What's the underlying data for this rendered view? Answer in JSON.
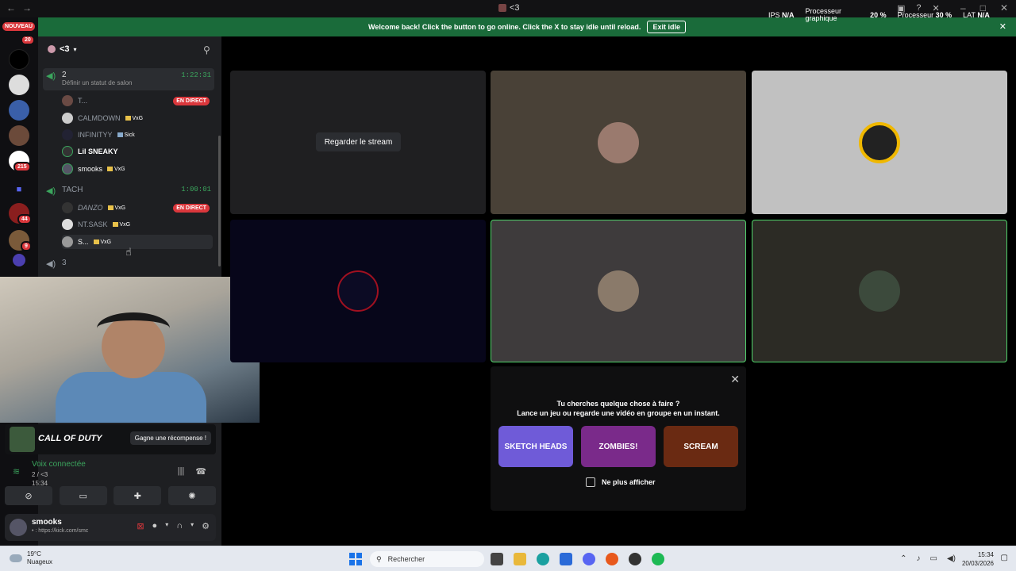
{
  "window": {
    "title": "<3"
  },
  "banner": {
    "message": "Welcome back! Click the button to go online. Click the X to stay idle until reload.",
    "exit_label": "Exit idle"
  },
  "perf": {
    "ips_label": "IPS",
    "ips_value": "N/A",
    "gpu_label_1": "Processeur",
    "gpu_label_2": "graphique",
    "gpu_value": "20 %",
    "cpu_label": "Processeur",
    "cpu_value": "30 %",
    "lat_label": "LAT",
    "lat_value": "N/A"
  },
  "servers": {
    "new_label": "NOUVEAU",
    "new_count": "20",
    "badge_a": "215",
    "badge_b": "44",
    "badge_c": "9"
  },
  "sidebar": {
    "server_name": "<3",
    "channels": [
      {
        "name": "2",
        "time": "1:22:31",
        "status": "Définir un statut de salon"
      },
      {
        "name": "TACH",
        "time": "1:00:01"
      },
      {
        "name": "3"
      }
    ],
    "members_ch1": [
      {
        "name": "T...",
        "tag": "",
        "live": "EN DIRECT"
      },
      {
        "name": "CALMDOWN",
        "tag": "VxG"
      },
      {
        "name": "INFINITYY",
        "tag": "Sick"
      },
      {
        "name": "Lil SNEAKY",
        "tag": ""
      },
      {
        "name": "smooks",
        "tag": "VxG"
      }
    ],
    "members_ch2": [
      {
        "name": "DANZO",
        "tag": "VxG",
        "live": "EN DIRECT"
      },
      {
        "name": "NT.SASK",
        "tag": "VxG"
      },
      {
        "name": "S...",
        "tag": "VxG"
      }
    ]
  },
  "promo": {
    "game": "CALL OF DUTY",
    "reward": "Gagne une récompense !"
  },
  "voice": {
    "status": "Voix connectée",
    "channel": "2 / <3",
    "time": "15:34"
  },
  "user": {
    "name": "smooks",
    "status": "• : https://kick.com/smc"
  },
  "stage": {
    "watch_stream": "Regarder le stream"
  },
  "activity": {
    "line1": "Tu cherches quelque chose à faire ?",
    "line2": "Lance un jeu ou regarde une vidéo en groupe en un instant.",
    "games": [
      "SKETCH HEADS",
      "ZOMBIES!",
      "SCREAM"
    ],
    "dont_show": "Ne plus afficher"
  },
  "taskbar": {
    "temp": "19°C",
    "weather": "Nuageux",
    "search": "Rechercher",
    "time": "15:34",
    "date": "20/03/2026"
  },
  "colors": {
    "accent_green": "#3ba55d",
    "live_red": "#da373c",
    "banner_green": "#1a6b3a"
  }
}
